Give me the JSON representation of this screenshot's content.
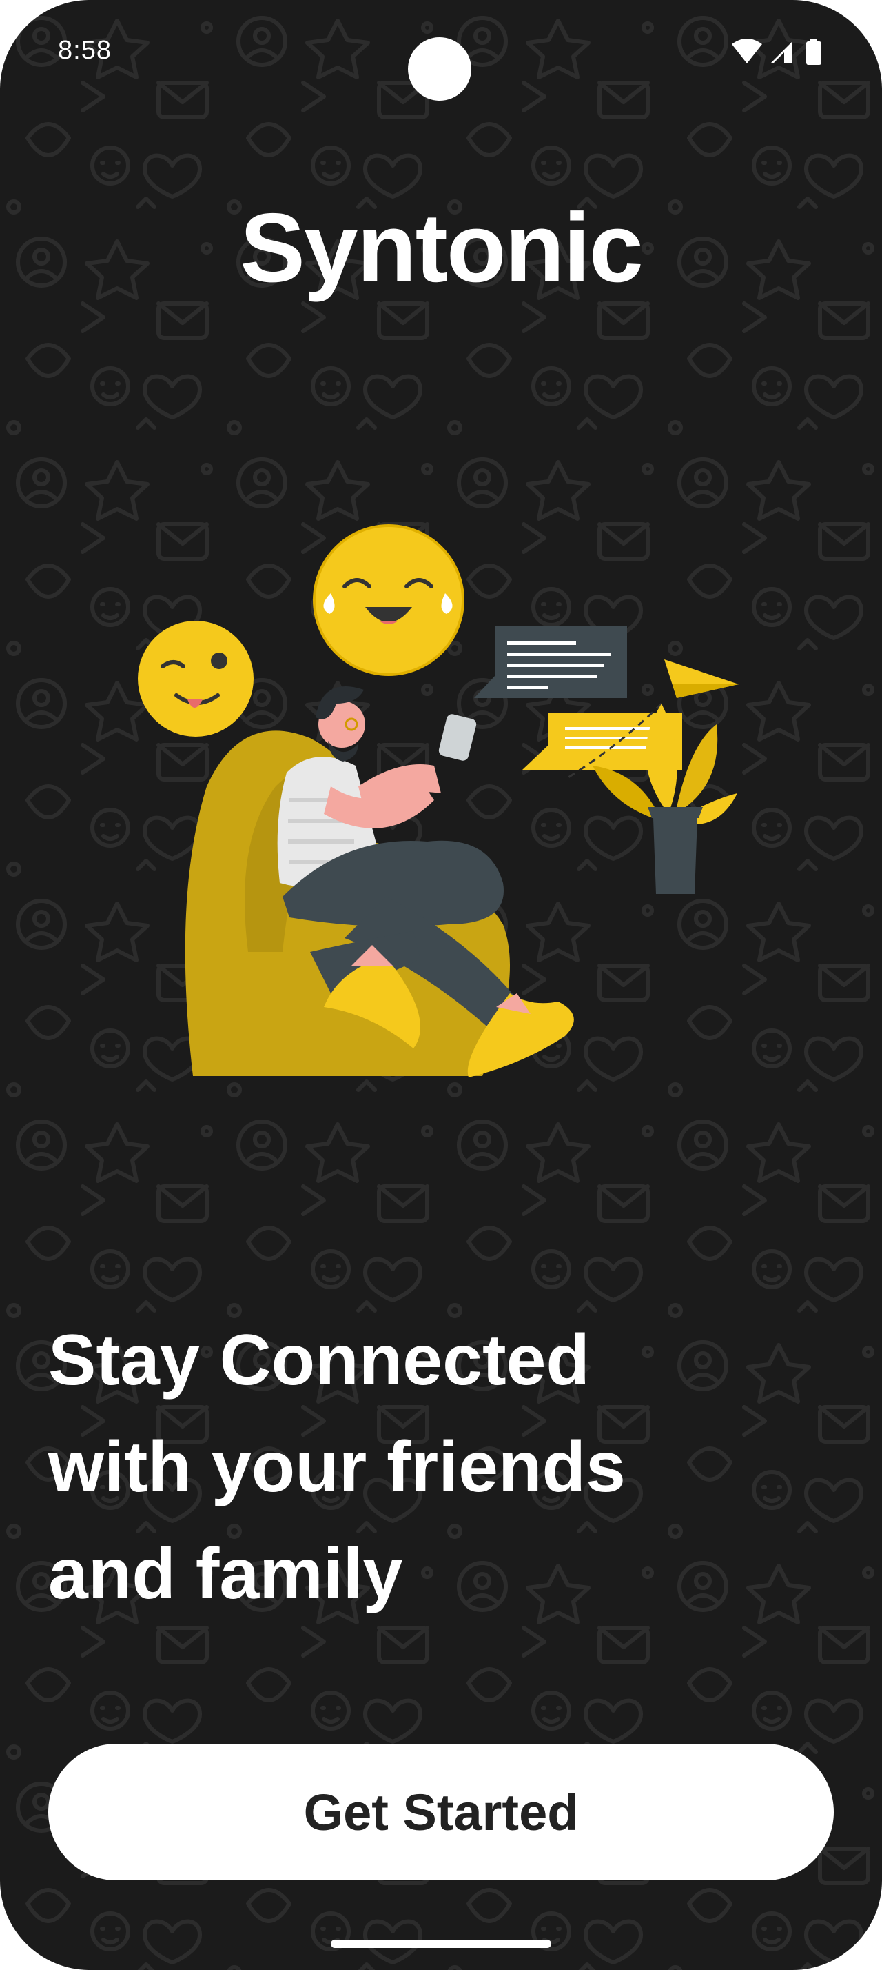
{
  "status_bar": {
    "time": "8:58",
    "icons": [
      "wifi-icon",
      "cellular-signal-icon",
      "battery-icon"
    ]
  },
  "app": {
    "title": "Syntonic"
  },
  "onboarding": {
    "headline_lines": [
      "Stay Connected",
      "with your friends",
      "and family"
    ],
    "cta_label": "Get Started"
  },
  "colors": {
    "background": "#1b1b1b",
    "accent_yellow": "#f5c91c",
    "text": "#ffffff",
    "button_bg": "#ffffff",
    "button_text": "#222222"
  }
}
